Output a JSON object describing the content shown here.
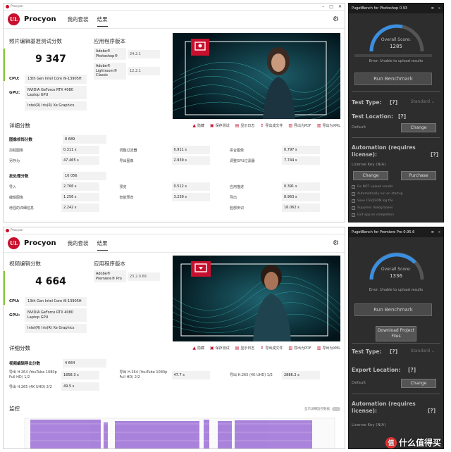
{
  "window_photoshop": {
    "titlebar": {
      "app": "Procyon"
    },
    "brand": "Procyon",
    "nav": [
      "我的套装",
      "结果"
    ],
    "score_title": "照片编辑基准测试分数",
    "score": "9 347",
    "hardware": [
      {
        "label": "CPU:",
        "value": "13th Gen Intel Core i9-13905H"
      },
      {
        "label": "GPU:",
        "value": "NVIDIA GeForce RTX 4080 Laptop GPU"
      },
      {
        "label": "",
        "value": "Intel(R) Iris(R) Xe Graphics"
      }
    ],
    "app_versions_title": "应用程序版本",
    "app_versions": [
      {
        "name": "Adobe® Photoshop®",
        "version": "24.2.1"
      },
      {
        "name": "Adobe® Lightroom® Classic",
        "version": "12.2.1"
      }
    ],
    "details_title": "详细分数",
    "tools": [
      "隐藏",
      "保存测试",
      "显示日志",
      "导出成文件",
      "导出为PDF",
      "导出为XML"
    ],
    "section1": {
      "label": "图像修饰分数",
      "value": "8 689"
    },
    "rows1": [
      [
        {
          "k": "加载图像",
          "v": "0.311 s"
        },
        {
          "k": "调整过滤器",
          "v": "0.911 s"
        },
        {
          "k": "拼合图像",
          "v": "0.797 s"
        }
      ],
      [
        {
          "k": "另存为",
          "v": "47.465 s"
        },
        {
          "k": "导出图像",
          "v": "2.939 s"
        },
        {
          "k": "调整GPU过滤器",
          "v": "7.744 s"
        }
      ]
    ],
    "section2": {
      "label": "批处理分数",
      "value": "10 056"
    },
    "rows2": [
      [
        {
          "k": "导入",
          "v": "2.766 s"
        },
        {
          "k": "预览",
          "v": "0.512 s"
        },
        {
          "k": "应用描述",
          "v": "0.391 s"
        }
      ],
      [
        {
          "k": "编辑图像",
          "v": "1.256 s"
        },
        {
          "k": "智能预览",
          "v": "3.239 s"
        },
        {
          "k": "导出",
          "v": "8.963 s"
        }
      ],
      [
        {
          "k": "增强的详细信息",
          "v": "2.242 s"
        },
        {
          "k": "",
          "v": ""
        },
        {
          "k": "脸部辨识",
          "v": "16.062 s"
        }
      ]
    ]
  },
  "window_premiere": {
    "titlebar": {
      "app": "Procyon"
    },
    "brand": "Procyon",
    "nav": [
      "我的套装",
      "结果"
    ],
    "score_title": "视频编辑分数",
    "score": "4 664",
    "hardware": [
      {
        "label": "CPU:",
        "value": "13th Gen Intel Core i9-13905H"
      },
      {
        "label": "GPU:",
        "value": "NVIDIA GeForce RTX 4080 Laptop GPU"
      },
      {
        "label": "",
        "value": "Intel(R) Iris(R) Xe Graphics"
      }
    ],
    "app_versions_title": "应用程序版本",
    "app_versions": [
      {
        "name": "Adobe® Premiere® Pro",
        "version": "23.2.0.69"
      }
    ],
    "details_title": "详细分数",
    "tools": [
      "隐藏",
      "保存测试",
      "显示日志",
      "导出成文件",
      "导出为PDF",
      "导出为XML"
    ],
    "section1": {
      "label": "视频编辑导出分数",
      "value": "4 664"
    },
    "rows1": [
      [
        {
          "k": "导出 H.264 (YouTube 1080p Full HD) 1/2",
          "v": "1858.3 s"
        },
        {
          "k": "导出 H.264 (YouTube 1080p Full HD) 2/2",
          "v": "47.7 s"
        },
        {
          "k": "导出 H.265 (4K UHD) 1/2",
          "v": "2886.2 s"
        }
      ],
      [
        {
          "k": "导出 H.265 (4K UHD) 2/2",
          "v": "49.5 s"
        },
        {
          "k": "",
          "v": ""
        },
        {
          "k": "",
          "v": ""
        }
      ]
    ],
    "monitor_title": "监控",
    "monitor_toggle": "显示详细监控数据"
  },
  "puget_photoshop": {
    "title": "PugetBench for Photoshop 0.93",
    "overall_label": "Overall Score:",
    "overall": "1285",
    "error": "Error: Unable to upload results",
    "run": "Run Benchmark",
    "test_type_label": "Test Type:",
    "help": "[?]",
    "test_type_value": "Standard",
    "test_location_label": "Test Location:",
    "test_location_default": "Default",
    "change": "Change",
    "automation_label": "Automation (requires license):",
    "license_key": "License Key (N/A)",
    "purchase": "Purchase",
    "options": [
      "Do NOT upload results",
      "Automatically run on startup",
      "Save CSV/JSON log file",
      "Suppress dialog boxes",
      "Exit app on completion"
    ]
  },
  "puget_premiere": {
    "title": "PugetBench for Premiere Pro 0.95.6",
    "overall_label": "Overall Score:",
    "overall": "1336",
    "error": "Error: Unable to upload results",
    "run": "Run Benchmark",
    "download": "Download Project Files",
    "test_type_label": "Test Type:",
    "help": "[?]",
    "test_type_value": "Standard",
    "export_location_label": "Export Location:",
    "export_default": "Default",
    "change": "Change",
    "automation_label": "Automation (requires license):",
    "license_key": "License Key (N/A)"
  },
  "watermark": {
    "badge": "值",
    "text": "什么值得买"
  },
  "colors": {
    "brand_red": "#c8102e",
    "score_green": "#8cc63f",
    "gauge_blue": "#3b8fe0",
    "monitor_purple": "#9b6fd6"
  }
}
